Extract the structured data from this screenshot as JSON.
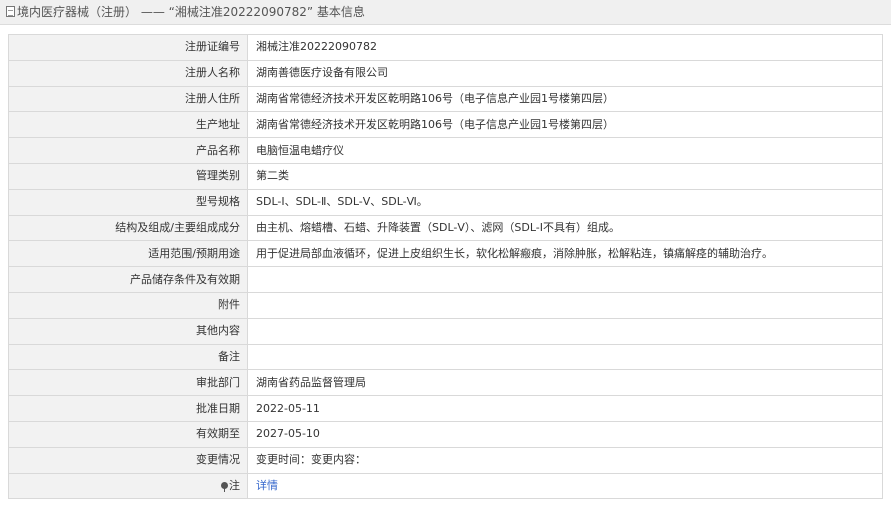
{
  "header": {
    "breadcrumb": "境内医疗器械（注册）",
    "separator": "——",
    "record_title": "“湘械注准20222090782”",
    "suffix": "基本信息"
  },
  "rows": [
    {
      "label": "注册证编号",
      "value": "湘械注准20222090782"
    },
    {
      "label": "注册人名称",
      "value": "湖南善德医疗设备有限公司"
    },
    {
      "label": "注册人住所",
      "value": "湖南省常德经济技术开发区乾明路106号（电子信息产业园1号楼第四层）"
    },
    {
      "label": "生产地址",
      "value": "湖南省常德经济技术开发区乾明路106号（电子信息产业园1号楼第四层）"
    },
    {
      "label": "产品名称",
      "value": "电脑恒温电蜡疗仪"
    },
    {
      "label": "管理类别",
      "value": "第二类"
    },
    {
      "label": "型号规格",
      "value": "SDL-Ⅰ、SDL-Ⅱ、SDL-Ⅴ、SDL-Ⅵ。"
    },
    {
      "label": "结构及组成/主要组成成分",
      "value": "由主机、熔蜡槽、石蜡、升降装置（SDL-Ⅴ）、滤网（SDL-Ⅰ不具有）组成。"
    },
    {
      "label": "适用范围/预期用途",
      "value": "用于促进局部血液循环，促进上皮组织生长，软化松解瘢痕，消除肿胀，松解粘连，镇痛解痉的辅助治疗。"
    },
    {
      "label": "产品储存条件及有效期",
      "value": ""
    },
    {
      "label": "附件",
      "value": ""
    },
    {
      "label": "其他内容",
      "value": ""
    },
    {
      "label": "备注",
      "value": ""
    },
    {
      "label": "审批部门",
      "value": "湖南省药品监督管理局"
    },
    {
      "label": "批准日期",
      "value": "2022-05-11"
    },
    {
      "label": "有效期至",
      "value": "2027-05-10"
    },
    {
      "label": "变更情况",
      "value": "变更时间：变更内容："
    }
  ],
  "note": {
    "label": "注",
    "link": "详情",
    "icon": "pin-icon"
  }
}
